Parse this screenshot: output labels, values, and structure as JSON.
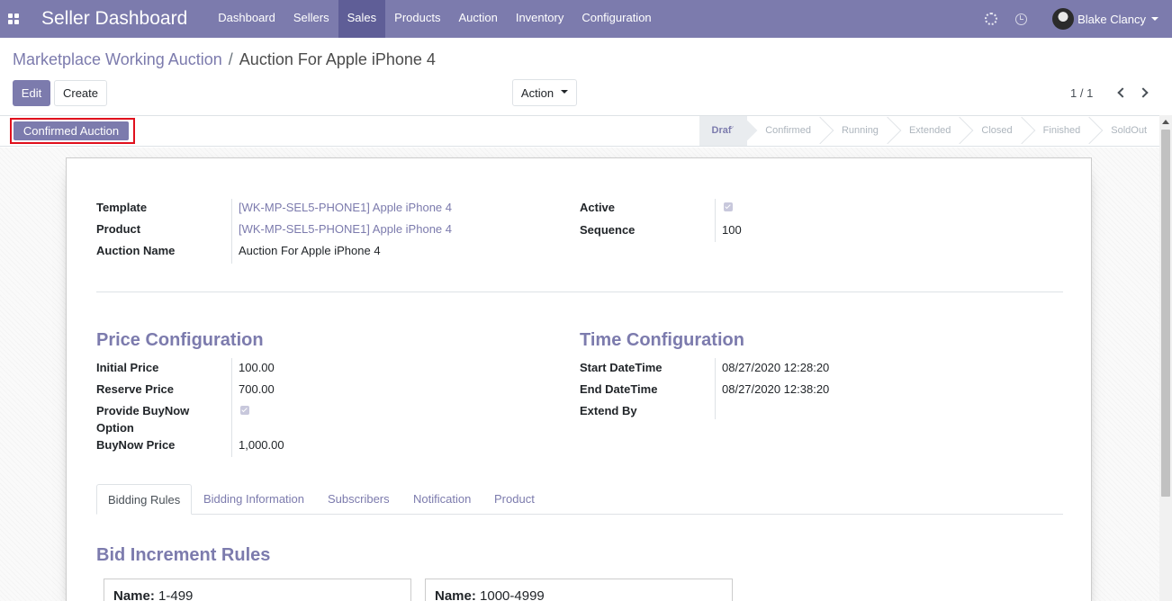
{
  "navbar": {
    "brand": "Seller Dashboard",
    "menu": [
      "Dashboard",
      "Sellers",
      "Sales",
      "Products",
      "Auction",
      "Inventory",
      "Configuration"
    ],
    "active_menu": "Sales",
    "user_name": "Blake Clancy"
  },
  "breadcrumb": {
    "parent": "Marketplace Working Auction",
    "separator": "/",
    "current": "Auction For Apple iPhone 4"
  },
  "controls": {
    "edit_label": "Edit",
    "create_label": "Create",
    "action_label": "Action",
    "pager": "1 / 1"
  },
  "statusbar": {
    "confirm_button": "Confirmed Auction",
    "stages": [
      "Draft",
      "Confirmed",
      "Running",
      "Extended",
      "Closed",
      "Finished",
      "SoldOut"
    ],
    "current_stage": "Draft"
  },
  "general": {
    "template_label": "Template",
    "template_value": "[WK-MP-SEL5-PHONE1] Apple iPhone 4",
    "product_label": "Product",
    "product_value": "[WK-MP-SEL5-PHONE1] Apple iPhone 4",
    "auction_name_label": "Auction Name",
    "auction_name_value": "Auction For Apple iPhone 4",
    "active_label": "Active",
    "active_checked": true,
    "sequence_label": "Sequence",
    "sequence_value": "100"
  },
  "price_config": {
    "title": "Price Configuration",
    "initial_price_label": "Initial Price",
    "initial_price_value": "100.00",
    "reserve_price_label": "Reserve Price",
    "reserve_price_value": "700.00",
    "buynow_option_label_1": "Provide BuyNow",
    "buynow_option_label_2": "Option",
    "buynow_option_checked": true,
    "buynow_price_label": "BuyNow Price",
    "buynow_price_value": "1,000.00"
  },
  "time_config": {
    "title": "Time Configuration",
    "start_label": "Start DateTime",
    "start_value": "08/27/2020 12:28:20",
    "end_label": "End DateTime",
    "end_value": "08/27/2020 12:38:20",
    "extend_label": "Extend By",
    "extend_value": ""
  },
  "tabs": [
    "Bidding Rules",
    "Bidding Information",
    "Subscribers",
    "Notification",
    "Product"
  ],
  "active_tab": "Bidding Rules",
  "bid_rules": {
    "title": "Bid Increment Rules",
    "name_label": "Name:",
    "cards": [
      "1-499",
      "1000-4999"
    ]
  },
  "colors": {
    "primary": "#7c7bad",
    "navbar_active": "#5f5e97",
    "highlight_border": "#e0101d"
  }
}
